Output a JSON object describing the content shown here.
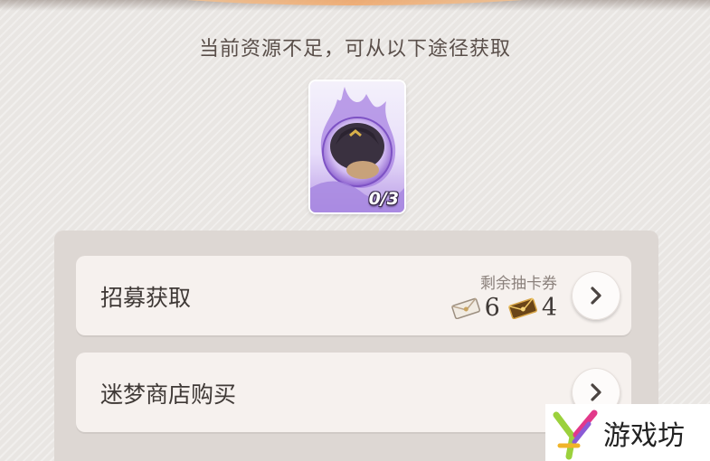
{
  "dialog": {
    "title": "当前资源不足，可从以下途径获取",
    "item_count": "0/3"
  },
  "options": [
    {
      "label": "招募获取",
      "ticket_caption": "剩余抽卡券",
      "tickets": [
        {
          "icon": "silver-ticket-icon",
          "count": "6"
        },
        {
          "icon": "gold-ticket-icon",
          "count": "4"
        }
      ]
    },
    {
      "label": "迷梦商店购买"
    }
  ],
  "watermark": {
    "text": "游戏坊",
    "logo": "y-logo-icon"
  },
  "colors": {
    "accent_purple": "#8e63d0",
    "panel": "#ddd7d3",
    "row": "#f6f1ee"
  }
}
